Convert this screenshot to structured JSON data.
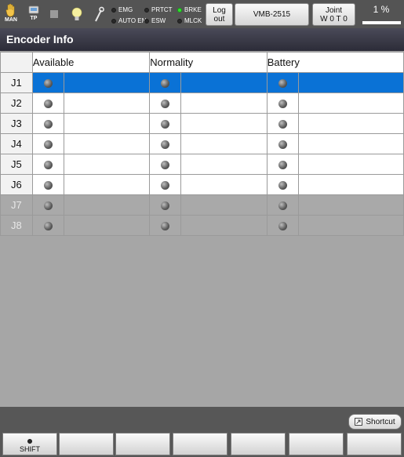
{
  "topbar": {
    "mode_label": "MAN",
    "tp_label": "TP",
    "indicators": {
      "emg": "EMG",
      "auto_en": "AUTO EN",
      "prtct": "PRTCT",
      "esw": "ESW",
      "brke": "BRKE",
      "mlck": "MLCK"
    },
    "logout_label": "Log out",
    "robot_name": "VMB-2515",
    "joint_title": "Joint",
    "joint_info": "W 0 T 0",
    "speed": "1 %"
  },
  "panel": {
    "title": "Encoder Info",
    "columns": [
      "Available",
      "Normality",
      "Battery"
    ],
    "rows": [
      {
        "label": "J1",
        "state": "selected"
      },
      {
        "label": "J2",
        "state": "normal"
      },
      {
        "label": "J3",
        "state": "normal"
      },
      {
        "label": "J4",
        "state": "normal"
      },
      {
        "label": "J5",
        "state": "normal"
      },
      {
        "label": "J6",
        "state": "normal"
      },
      {
        "label": "J7",
        "state": "disabled"
      },
      {
        "label": "J8",
        "state": "disabled"
      }
    ]
  },
  "bottom": {
    "shortcut_label": "Shortcut",
    "shift_label": "SHIFT"
  }
}
